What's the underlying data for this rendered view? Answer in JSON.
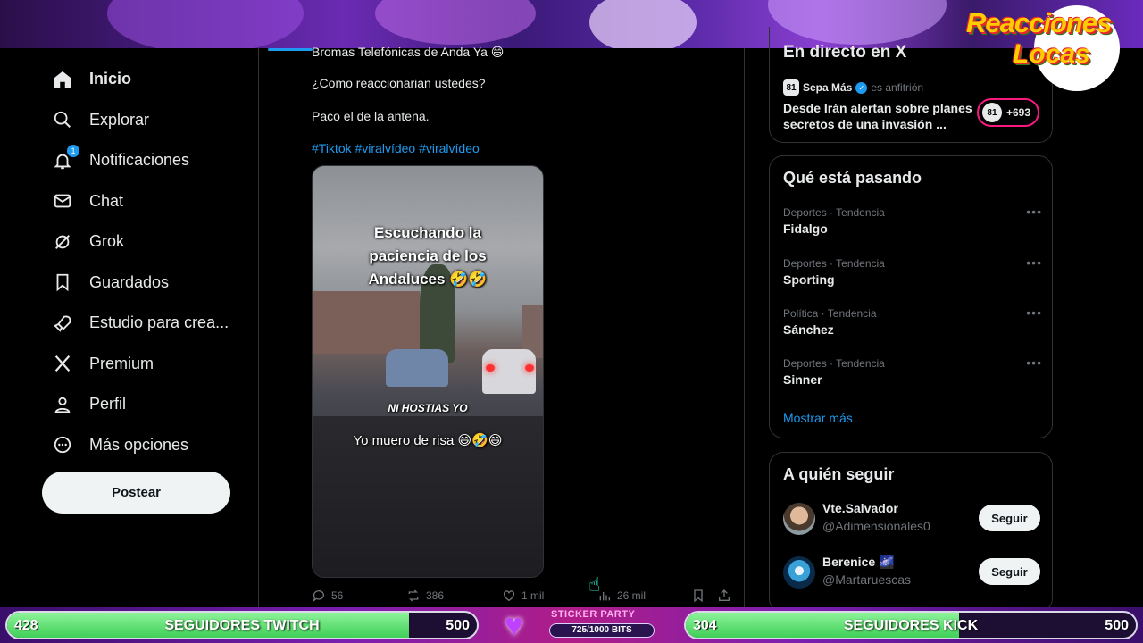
{
  "overlay": {
    "logo_line1": "Reacciones",
    "logo_line2": "Locas",
    "twitch": {
      "current": "428",
      "label": "SEGUIDORES TWITCH",
      "goal": "500",
      "progress": 0.856
    },
    "kick": {
      "current": "304",
      "label": "SEGUIDORES KICK",
      "goal": "500",
      "progress": 0.608
    },
    "sticker": {
      "title": "STICKER PARTY",
      "bits": "725/1000 BITS",
      "progress": 0.725
    }
  },
  "nav": {
    "items": [
      {
        "label": "Inicio",
        "icon": "home-icon"
      },
      {
        "label": "Explorar",
        "icon": "search-icon"
      },
      {
        "label": "Notificaciones",
        "icon": "bell-icon",
        "badge": "1"
      },
      {
        "label": "Chat",
        "icon": "mail-icon"
      },
      {
        "label": "Grok",
        "icon": "grok-icon"
      },
      {
        "label": "Guardados",
        "icon": "bookmark-icon"
      },
      {
        "label": "Estudio para crea...",
        "icon": "rocket-icon"
      },
      {
        "label": "Premium",
        "icon": "x-logo-icon"
      },
      {
        "label": "Perfil",
        "icon": "person-icon"
      },
      {
        "label": "Más opciones",
        "icon": "more-circle-icon"
      }
    ],
    "post_button": "Postear"
  },
  "tweet": {
    "line0": "Bromas Telefónicas de Anda Ya 😄",
    "line1": "¿Como reaccionarian ustedes?",
    "line2": "Paco el de la antena.",
    "hashtags": "#Tiktok #viralvídeo #viralvídeo",
    "video": {
      "caption_top": "Escuchando la paciencia de los Andaluces 🤣🤣",
      "caption_mid": "NI HOSTIAS YO",
      "caption_bottom": "Yo muero de risa 😄🤣😄"
    },
    "stats": {
      "replies": "56",
      "reposts": "386",
      "likes": "1 mil",
      "views": "26 mil"
    }
  },
  "live": {
    "header": "En directo en X",
    "host_name": "Sepa Más",
    "host_role": "es anfitrión",
    "host_logo": "81",
    "title": "Desde Irán alertan sobre planes secretos de una invasión ...",
    "listeners": "+693"
  },
  "trends": {
    "header": "Qué está pasando",
    "items": [
      {
        "meta": "Deportes · Tendencia",
        "name": "Fidalgo"
      },
      {
        "meta": "Deportes · Tendencia",
        "name": "Sporting"
      },
      {
        "meta": "Política · Tendencia",
        "name": "Sánchez"
      },
      {
        "meta": "Deportes · Tendencia",
        "name": "Sinner"
      }
    ],
    "show_more": "Mostrar más"
  },
  "follow": {
    "header": "A quién seguir",
    "users": [
      {
        "name": "Vte.Salvador",
        "handle": "@Adimensionales0",
        "button": "Seguir"
      },
      {
        "name": "Berenice 🌌",
        "handle": "@Martaruescas",
        "button": "Seguir"
      }
    ]
  },
  "colors": {
    "accent": "#1d9bf0",
    "background": "#000000",
    "text": "#e7e9ea",
    "muted": "#71767b",
    "progress_green": "#3fcf57"
  }
}
